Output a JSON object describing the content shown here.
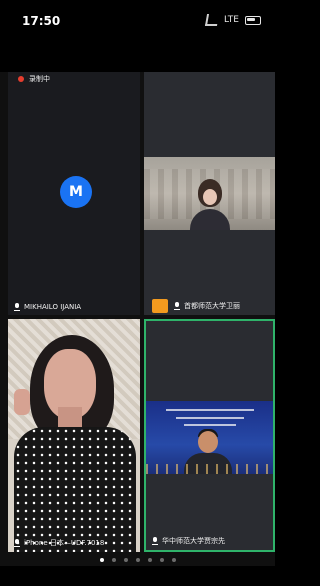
{
  "status_bar": {
    "time": "17:50",
    "network": "LTE"
  },
  "tiles": [
    {
      "recording_label": "录制中",
      "avatar_initial": "M",
      "name": "MIKHAILO IJANIA",
      "muted": true
    },
    {
      "name": "首都师范大学卫丽",
      "muted": true
    },
    {
      "name": "iPhone 日本—UDF.7018",
      "muted": true
    },
    {
      "name": "华中师范大学贾宗先",
      "muted": true,
      "active_speaker": true
    }
  ],
  "pagination": {
    "count": 7,
    "active_index": 0
  },
  "colors": {
    "avatar_bg": "#1a73f3",
    "active_border": "#2fb36a",
    "record_dot": "#e63d2e",
    "badge_orange": "#f29a1f"
  }
}
